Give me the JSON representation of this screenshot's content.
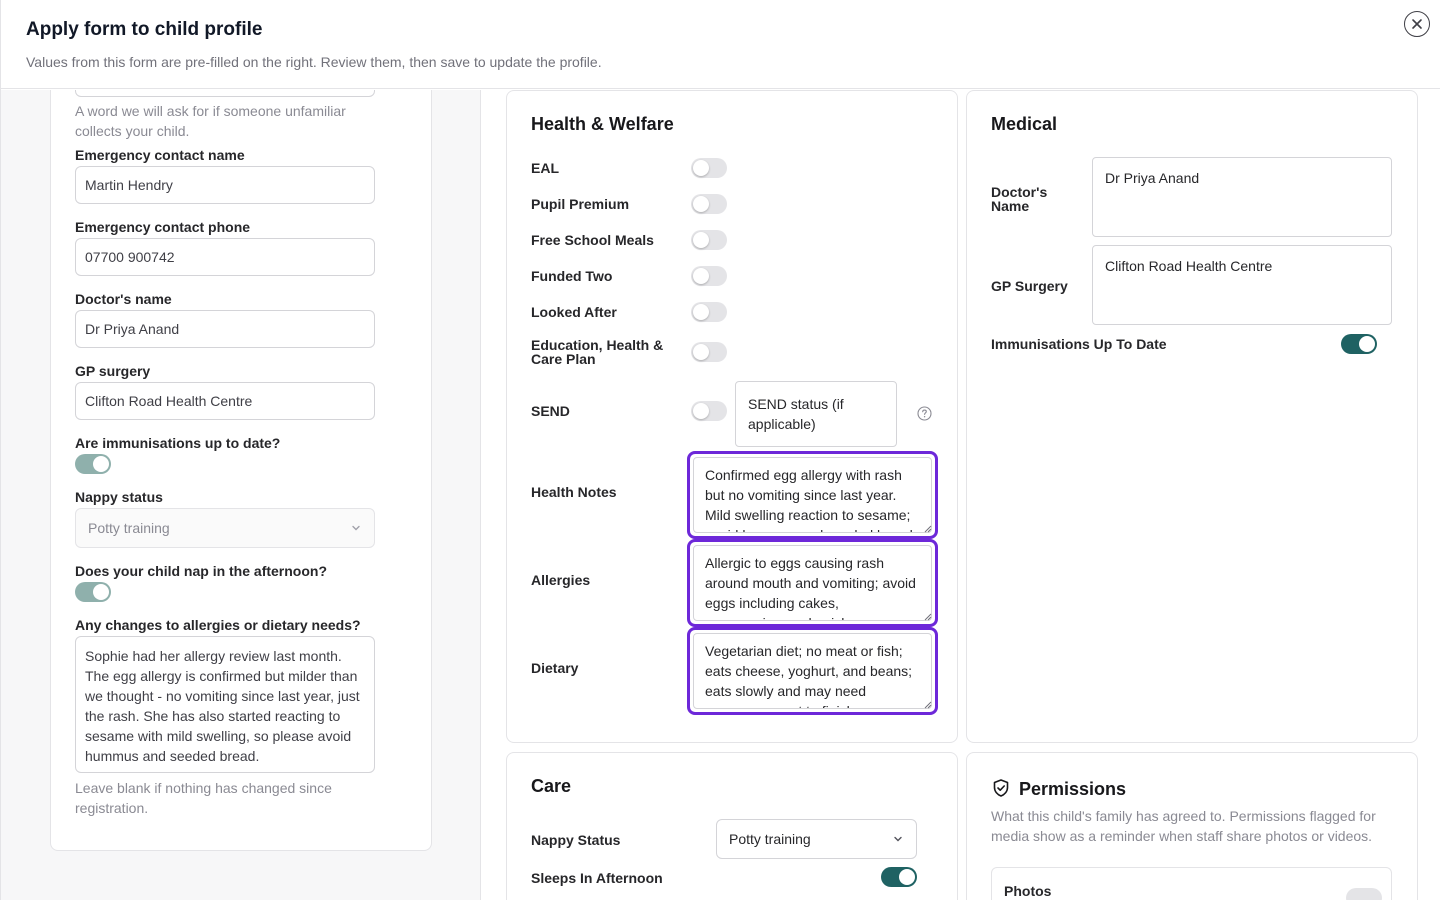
{
  "modal": {
    "title": "Apply form to child profile",
    "subtitle": "Values from this form are pre-filled on the right. Review them, then save to update the profile."
  },
  "form": {
    "password_help": "A word we will ask for if someone unfamiliar collects your child.",
    "emergency_name_label": "Emergency contact name",
    "emergency_name_value": "Martin Hendry",
    "emergency_phone_label": "Emergency contact phone",
    "emergency_phone_value": "07700 900742",
    "doctor_label": "Doctor's name",
    "doctor_value": "Dr Priya Anand",
    "gp_label": "GP surgery",
    "gp_value": "Clifton Road Health Centre",
    "immunisations_label": "Are immunisations up to date?",
    "immunisations_on": true,
    "nappy_label": "Nappy status",
    "nappy_value": "Potty training",
    "nap_label": "Does your child nap in the afternoon?",
    "nap_on": true,
    "allergies_label": "Any changes to allergies or dietary needs?",
    "allergies_value": "Sophie had her allergy review last month. The egg allergy is confirmed but milder than we thought - no vomiting since last year, just the rash. She has also started reacting to sesame with mild swelling, so please avoid hummus and seeded bread.",
    "allergies_help": "Leave blank if nothing has changed since registration."
  },
  "health": {
    "title": "Health & Welfare",
    "eal": "EAL",
    "pupil_premium": "Pupil Premium",
    "free_school_meals": "Free School Meals",
    "funded_two": "Funded Two",
    "looked_after": "Looked After",
    "ehcp": "Education, Health & Care Plan",
    "send": "SEND",
    "send_status": "SEND status (if applicable)",
    "health_notes_label": "Health Notes",
    "health_notes_value": "Confirmed egg allergy with rash but no vomiting since last year. Mild swelling reaction to sesame; avoid hummus and seeded bread.",
    "allergies_label": "Allergies",
    "allergies_value": "Allergic to eggs causing rash around mouth and vomiting; avoid eggs including cakes, mayonnaise, and quiche; no",
    "dietary_label": "Dietary",
    "dietary_value": "Vegetarian diet; no meat or fish; eats cheese, yoghurt, and beans; eats slowly and may need encouragement to finish",
    "highlight_color": "#6d28d9"
  },
  "medical": {
    "title": "Medical",
    "doctor_label": "Doctor's Name",
    "doctor_value": "Dr Priya Anand",
    "gp_label": "GP Surgery",
    "gp_value": "Clifton Road Health Centre",
    "immunisations_label": "Immunisations Up To Date",
    "immunisations_on": true,
    "toggle_color": "#1f6263"
  },
  "care": {
    "title": "Care",
    "nappy_label": "Nappy Status",
    "nappy_value": "Potty training",
    "sleeps_label": "Sleeps In Afternoon",
    "sleeps_on": true
  },
  "permissions": {
    "title": "Permissions",
    "description": "What this child's family has agreed to. Permissions flagged for media show as a reminder when staff share photos or videos.",
    "items": [
      {
        "label": "Photos"
      }
    ]
  }
}
